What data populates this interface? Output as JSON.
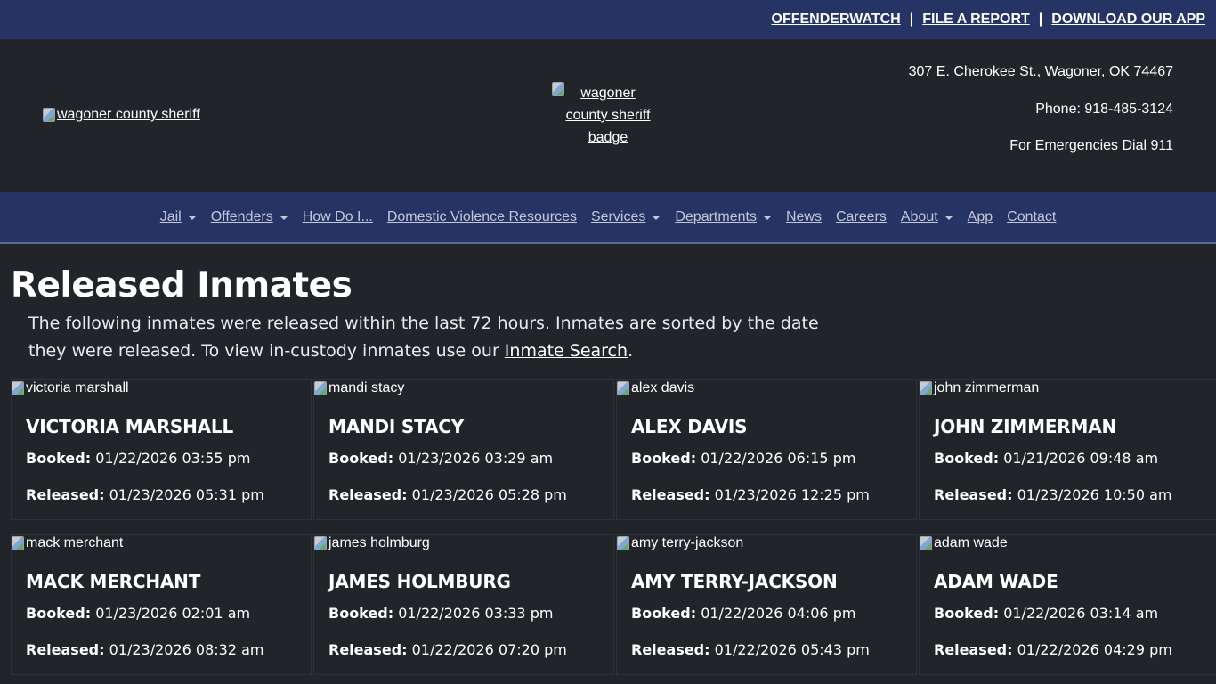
{
  "topbar": {
    "links": [
      "OFFENDERWATCH",
      "FILE A REPORT",
      "DOWNLOAD OUR APP"
    ],
    "separator": "|"
  },
  "header": {
    "logo_alt": "wagoner county sheriff",
    "badge_alt_lines": [
      "wagoner",
      "county sheriff",
      "badge"
    ],
    "address": "307 E. Cherokee St., Wagoner, OK 74467",
    "phone": "Phone: 918-485-3124",
    "emergency": "For Emergencies Dial 911"
  },
  "nav": {
    "items": [
      {
        "label": "Jail",
        "dropdown": true
      },
      {
        "label": "Offenders",
        "dropdown": true
      },
      {
        "label": "How Do I...",
        "dropdown": false
      },
      {
        "label": "Domestic Violence Resources",
        "dropdown": false
      },
      {
        "label": "Services",
        "dropdown": true
      },
      {
        "label": "Departments",
        "dropdown": true
      },
      {
        "label": "News",
        "dropdown": false
      },
      {
        "label": "Careers",
        "dropdown": false
      },
      {
        "label": "About",
        "dropdown": true
      },
      {
        "label": "App",
        "dropdown": false
      },
      {
        "label": "Contact",
        "dropdown": false
      }
    ]
  },
  "main": {
    "title": "Released Inmates",
    "intro_before": "The following inmates were released within the last 72 hours. Inmates are sorted by the date they were released. To view in-custody inmates use our ",
    "intro_link": "Inmate Search",
    "intro_after": ".",
    "booked_label": "Booked:",
    "released_label": "Released:"
  },
  "inmates": [
    {
      "alt": "victoria marshall",
      "name": "VICTORIA MARSHALL",
      "booked": "01/22/2026 03:55 pm",
      "released": "01/23/2026 05:31 pm"
    },
    {
      "alt": "mandi stacy",
      "name": "MANDI STACY",
      "booked": "01/23/2026 03:29 am",
      "released": "01/23/2026 05:28 pm"
    },
    {
      "alt": "alex davis",
      "name": "ALEX DAVIS",
      "booked": "01/22/2026 06:15 pm",
      "released": "01/23/2026 12:25 pm"
    },
    {
      "alt": "john zimmerman",
      "name": "JOHN ZIMMERMAN",
      "booked": "01/21/2026 09:48 am",
      "released": "01/23/2026 10:50 am"
    },
    {
      "alt": "mack merchant",
      "name": "MACK MERCHANT",
      "booked": "01/23/2026 02:01 am",
      "released": "01/23/2026 08:32 am"
    },
    {
      "alt": "james holmburg",
      "name": "JAMES HOLMBURG",
      "booked": "01/22/2026 03:33 pm",
      "released": "01/22/2026 07:20 pm"
    },
    {
      "alt": "amy terry-jackson",
      "name": "AMY TERRY-JACKSON",
      "booked": "01/22/2026 04:06 pm",
      "released": "01/22/2026 05:43 pm"
    },
    {
      "alt": "adam wade",
      "name": "ADAM WADE",
      "booked": "01/22/2026 03:14 am",
      "released": "01/22/2026 04:29 pm"
    }
  ]
}
